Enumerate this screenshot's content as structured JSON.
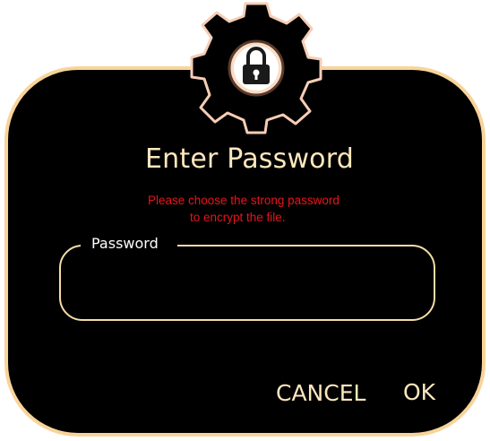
{
  "dialog": {
    "title": "Enter Password",
    "hint_line1": "Please choose the strong password",
    "hint_line2": "to encrypt the file.",
    "icon": "lock-gear-icon"
  },
  "password_field": {
    "label": "Password",
    "value": "",
    "placeholder": ""
  },
  "buttons": {
    "cancel": "CANCEL",
    "ok": "OK"
  },
  "colors": {
    "background": "#000000",
    "border": "#f8d49a",
    "text": "#fde7bd",
    "hint": "#e8141c"
  }
}
